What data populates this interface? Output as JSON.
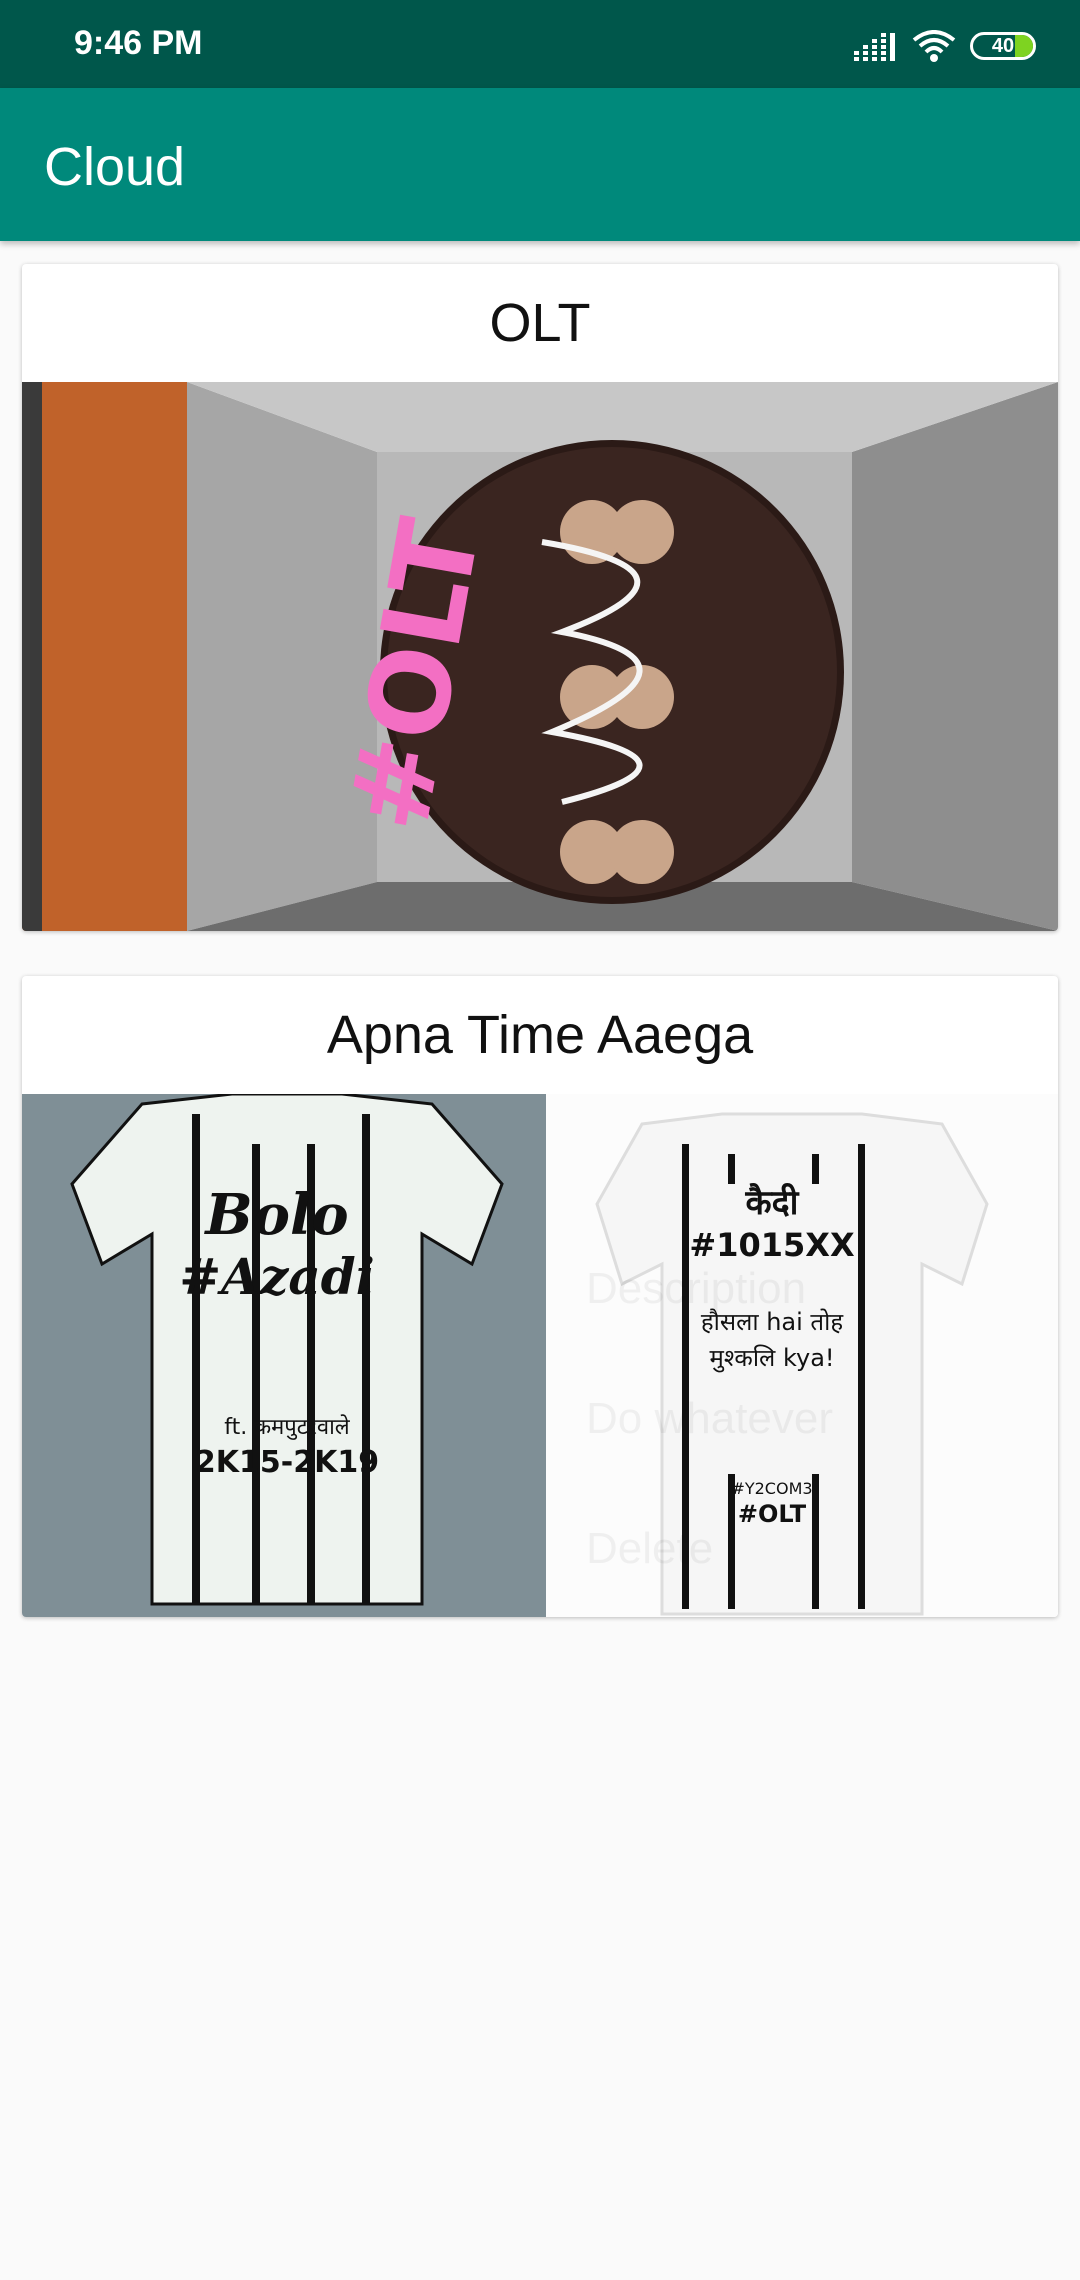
{
  "status_bar": {
    "time": "9:46 PM",
    "battery_level": "40",
    "icons": [
      "signal-icon",
      "wifi-icon",
      "battery-icon"
    ]
  },
  "app_bar": {
    "title": "Cloud",
    "background": "#00897b",
    "status_background": "#00574b"
  },
  "cards": [
    {
      "title": "OLT",
      "image": {
        "description_icon": "cake-photo",
        "text": "#OLT"
      }
    },
    {
      "title": "Apna Time Aaega",
      "image": {
        "left_shirt": {
          "line1": "Bolo",
          "line2": "#Azadi",
          "line3": "ft. कमपुटरवाले",
          "line4": "2K15-2K19"
        },
        "right_shirt": {
          "line1": "कैदी",
          "line2": "#1015XX",
          "line3": "हौसला hai तोह",
          "line4": "मुश्कलि kya!",
          "line5": "#Y2COM3",
          "line6": "#OLT"
        },
        "faded_menu": [
          "Description",
          "Do whatever",
          "Delete"
        ]
      }
    }
  ]
}
